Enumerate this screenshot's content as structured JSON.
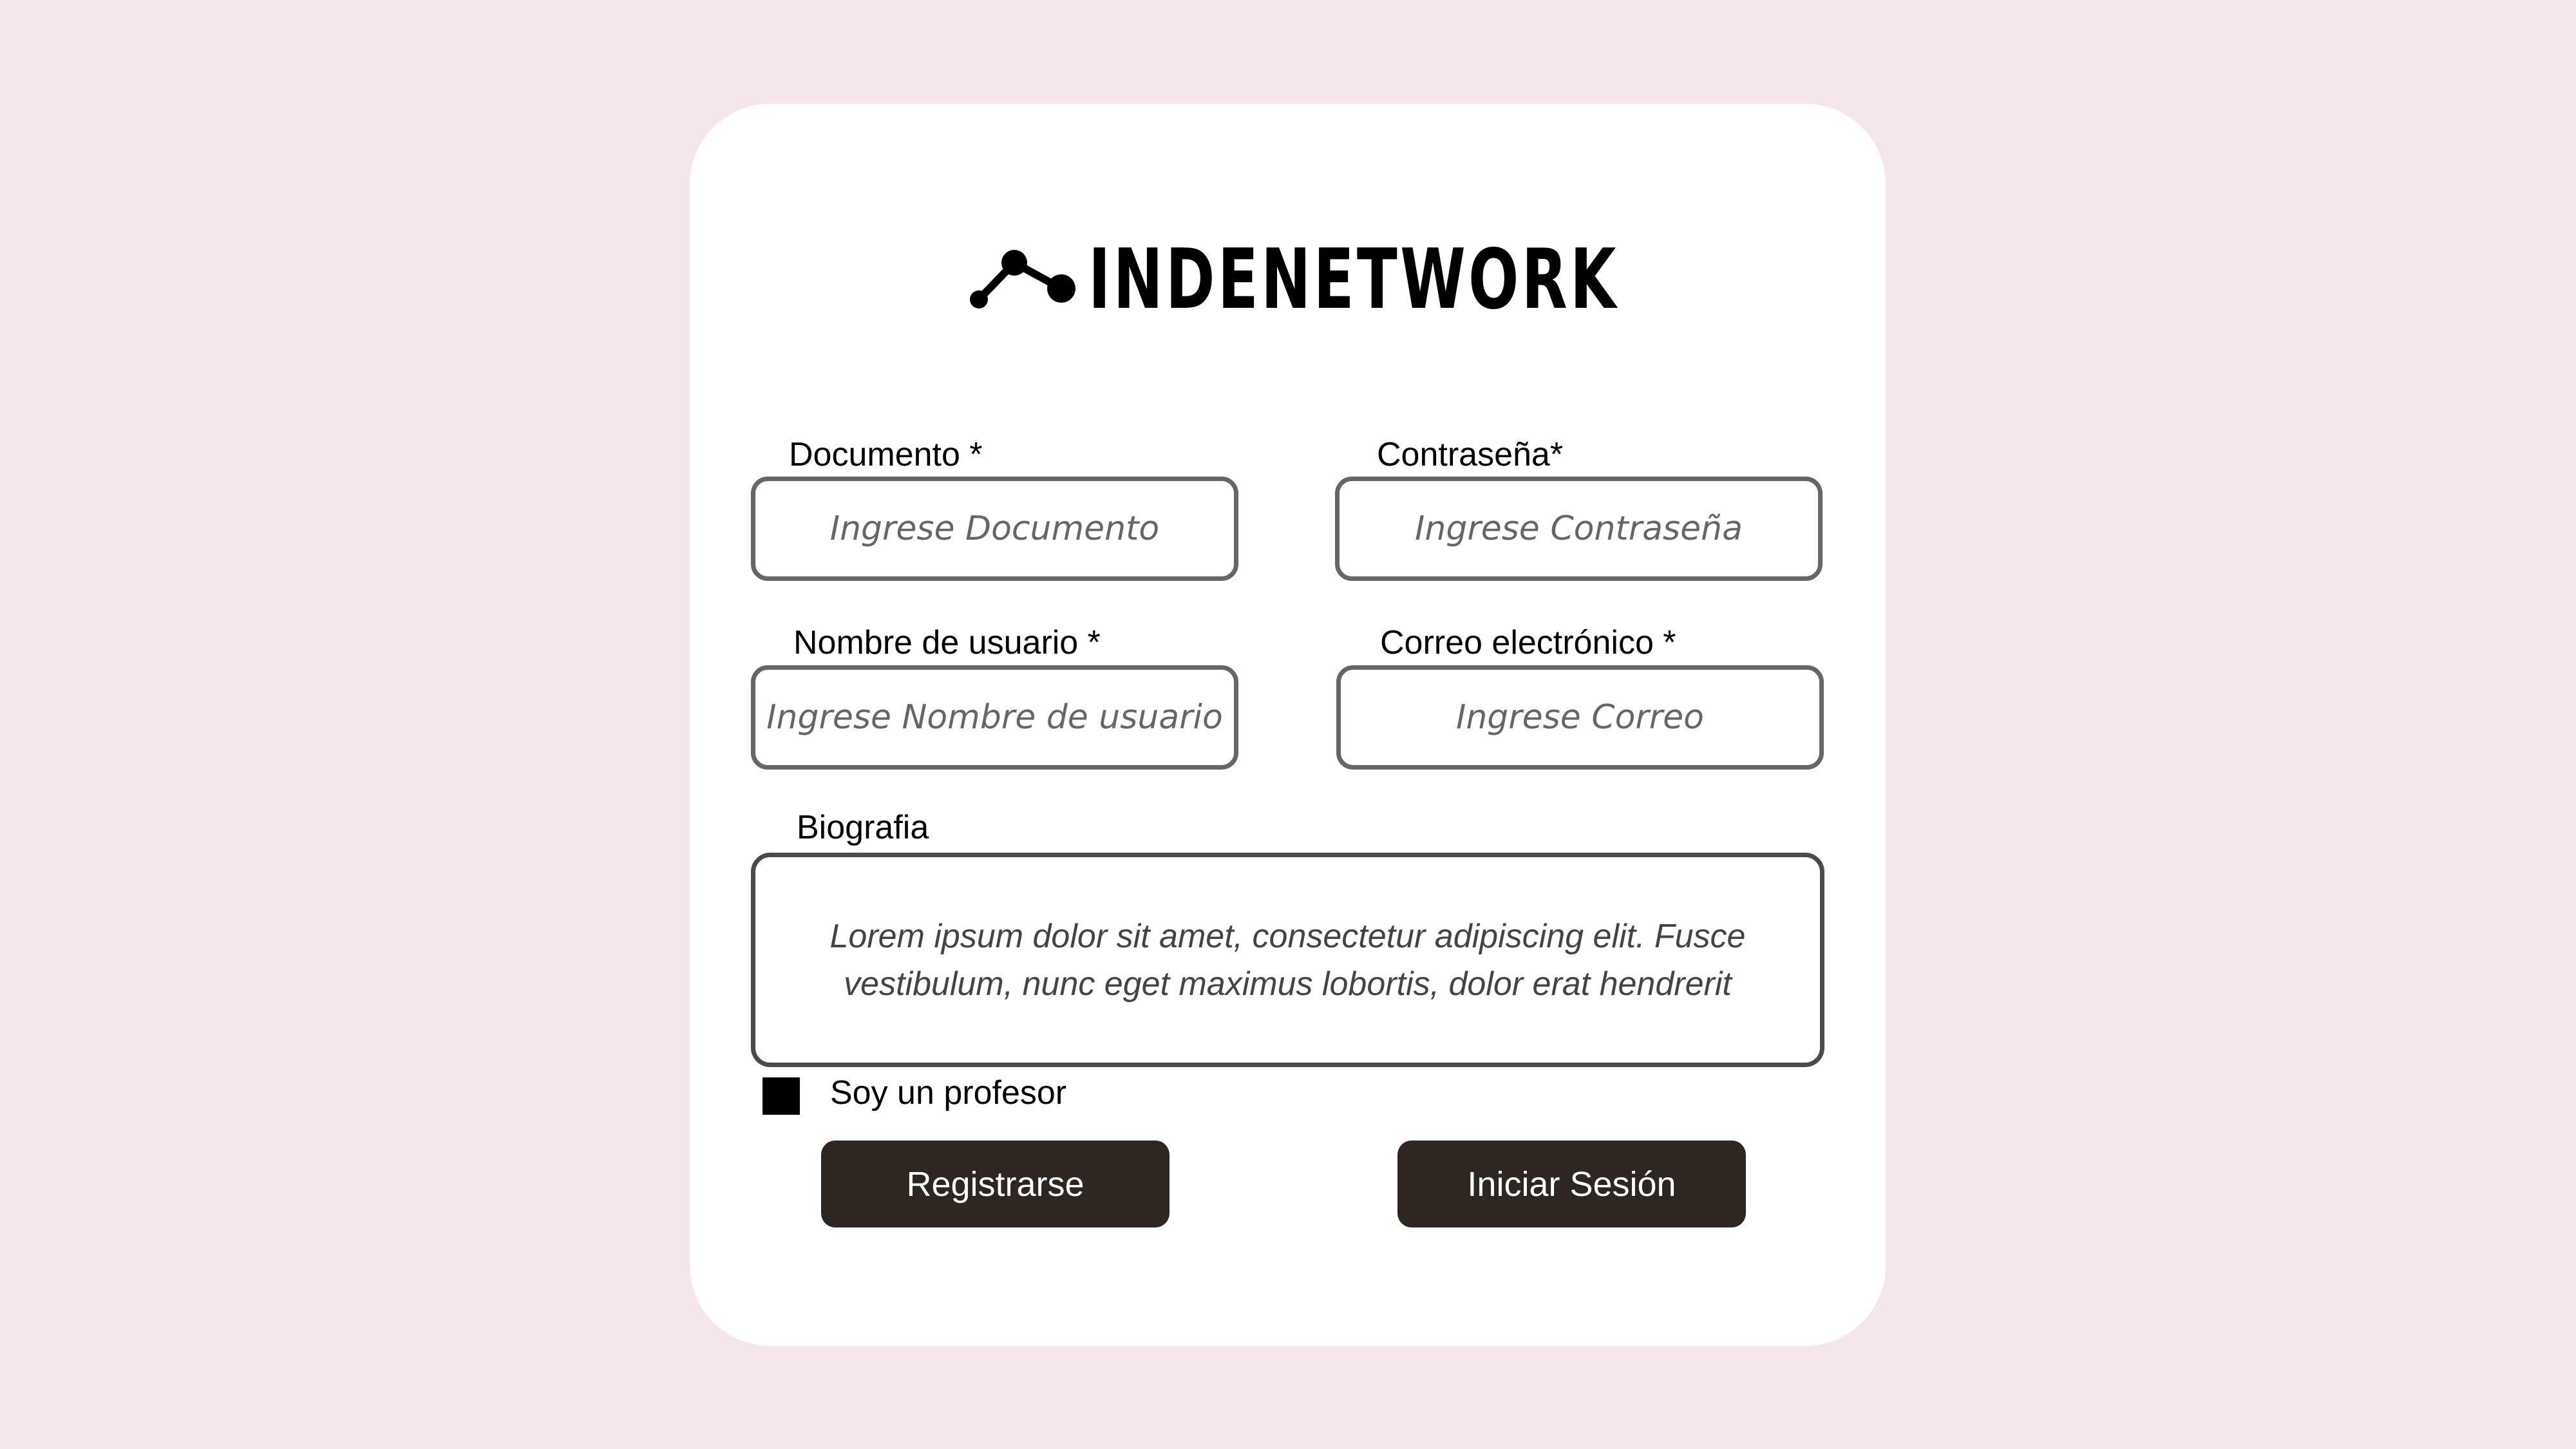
{
  "app": {
    "brand": "INDENETWORK"
  },
  "form": {
    "documento": {
      "label": "Documento *",
      "placeholder": "Ingrese Documento",
      "value": ""
    },
    "contrasena": {
      "label": "Contraseña*",
      "placeholder": "Ingrese Contraseña",
      "value": ""
    },
    "nombre_usuario": {
      "label": "Nombre de usuario *",
      "placeholder": "Ingrese Nombre de usuario",
      "value": ""
    },
    "correo": {
      "label": "Correo electrónico *",
      "placeholder": "Ingrese Correo",
      "value": ""
    },
    "biografia": {
      "label": "Biografia",
      "text": "Lorem ipsum dolor sit amet, consectetur adipiscing elit. Fusce vestibulum, nunc eget maximus lobortis, dolor erat hendrerit"
    },
    "profesor_checkbox": {
      "label": "Soy un profesor",
      "checked": true
    }
  },
  "actions": {
    "register_label": "Registrarse",
    "login_label": "Iniciar Sesión"
  },
  "colors": {
    "background": "#f5e6e9",
    "card": "#ffffff",
    "button": "#2e2721",
    "field_border": "#666666"
  },
  "icons": {
    "logo": "network-nodes-icon",
    "checkbox": "checkbox-icon"
  }
}
